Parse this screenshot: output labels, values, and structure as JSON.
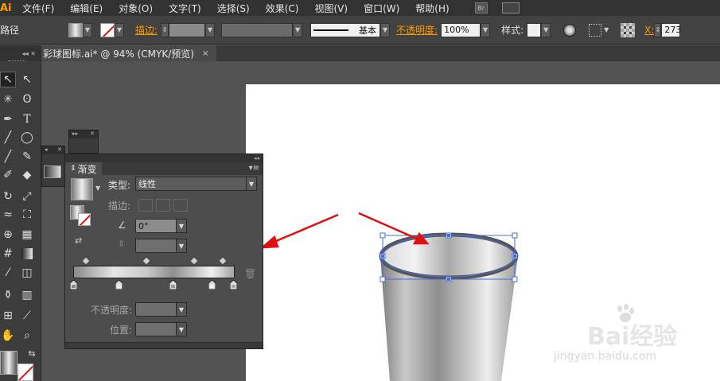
{
  "menubar": {
    "logo": "Ai",
    "items": [
      "文件(F)",
      "编辑(E)",
      "对象(O)",
      "文字(T)",
      "选择(S)",
      "效果(C)",
      "视图(V)",
      "窗口(W)",
      "帮助(H)"
    ],
    "bridge": "Br"
  },
  "controlbar": {
    "path_label": "路径",
    "stroke_label": "描边:",
    "brush_value": "基本",
    "opacity_label": "不透明度:",
    "opacity_value": "100%",
    "style_label": "样式:",
    "x_label": "X:",
    "x_value": "273"
  },
  "document": {
    "tab_title": "彩球图标.ai* @ 94% (CMYK/预览)",
    "close": "×"
  },
  "gradient_panel": {
    "tab_label": "渐变",
    "type_label": "类型:",
    "type_value": "线性",
    "stroke_label": "描边:",
    "angle_value": "0°",
    "opacity_label": "不透明度:",
    "position_label": "位置:"
  },
  "watermark": {
    "brand": "Bai经验",
    "url": "jingyan.baidu.com"
  },
  "colors": {
    "accent": "#ff9a00",
    "arrow": "#e01010",
    "selection": "#4a6cd4"
  }
}
